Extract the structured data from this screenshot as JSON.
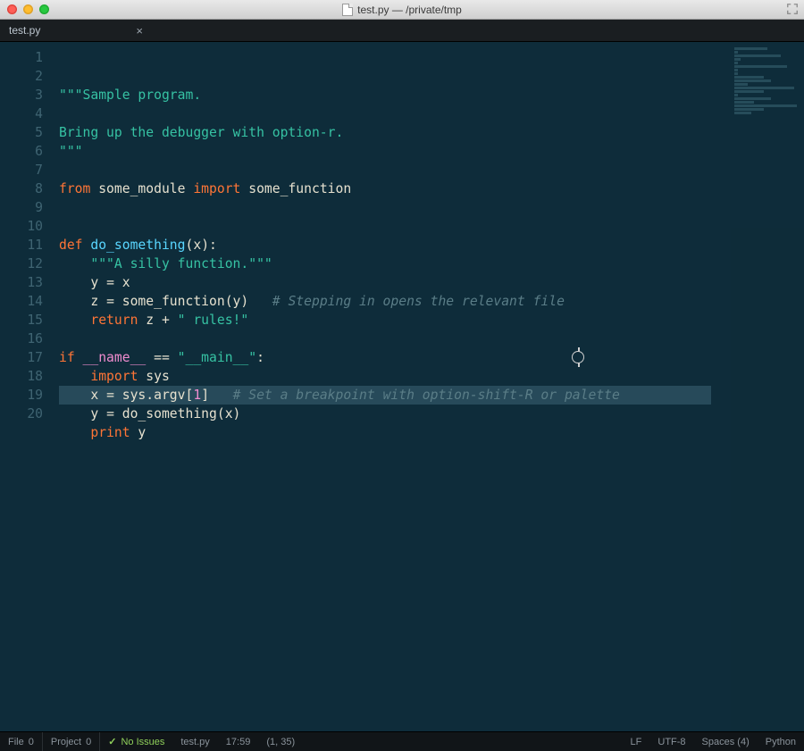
{
  "window": {
    "title": "test.py — /private/tmp"
  },
  "tabs": [
    {
      "label": "test.py",
      "active": true
    }
  ],
  "gutter": {
    "from": 1,
    "to": 20
  },
  "code": {
    "lines": [
      {
        "n": 1,
        "tokens": [
          [
            "str",
            "\"\"\"Sample program."
          ]
        ]
      },
      {
        "n": 2,
        "tokens": []
      },
      {
        "n": 3,
        "tokens": [
          [
            "str",
            "Bring up the debugger with option-r."
          ]
        ]
      },
      {
        "n": 4,
        "tokens": [
          [
            "str",
            "\"\"\""
          ]
        ]
      },
      {
        "n": 5,
        "tokens": []
      },
      {
        "n": 6,
        "tokens": [
          [
            "kw",
            "from"
          ],
          [
            "pln",
            " some_module "
          ],
          [
            "kw",
            "import"
          ],
          [
            "pln",
            " some_function"
          ]
        ]
      },
      {
        "n": 7,
        "tokens": []
      },
      {
        "n": 8,
        "tokens": []
      },
      {
        "n": 9,
        "tokens": [
          [
            "kw",
            "def "
          ],
          [
            "fn",
            "do_something"
          ],
          [
            "pln",
            "("
          ],
          [
            "pln",
            "x"
          ],
          [
            "pln",
            "):"
          ]
        ]
      },
      {
        "n": 10,
        "tokens": [
          [
            "pln",
            "    "
          ],
          [
            "str",
            "\"\"\"A silly function.\"\"\""
          ]
        ]
      },
      {
        "n": 11,
        "tokens": [
          [
            "pln",
            "    y "
          ],
          [
            "op",
            "="
          ],
          [
            "pln",
            " x"
          ]
        ]
      },
      {
        "n": 12,
        "tokens": [
          [
            "pln",
            "    z "
          ],
          [
            "op",
            "="
          ],
          [
            "pln",
            " some_function(y)   "
          ],
          [
            "cmt",
            "# Stepping in opens the relevant file"
          ]
        ]
      },
      {
        "n": 13,
        "tokens": [
          [
            "pln",
            "    "
          ],
          [
            "kw",
            "return"
          ],
          [
            "pln",
            " z "
          ],
          [
            "op",
            "+"
          ],
          [
            "pln",
            " "
          ],
          [
            "str",
            "\" rules!\""
          ]
        ]
      },
      {
        "n": 14,
        "tokens": []
      },
      {
        "n": 15,
        "tokens": [
          [
            "kw",
            "if"
          ],
          [
            "pln",
            " "
          ],
          [
            "dunder",
            "__name__"
          ],
          [
            "pln",
            " "
          ],
          [
            "op",
            "=="
          ],
          [
            "pln",
            " "
          ],
          [
            "str",
            "\"__main__\""
          ],
          [
            "pln",
            ":"
          ]
        ]
      },
      {
        "n": 16,
        "tokens": [
          [
            "pln",
            "    "
          ],
          [
            "kw",
            "import"
          ],
          [
            "pln",
            " sys"
          ]
        ]
      },
      {
        "n": 17,
        "tokens": [
          [
            "pln",
            "    x "
          ],
          [
            "op",
            "="
          ],
          [
            "pln",
            " sys.argv["
          ],
          [
            "num",
            "1"
          ],
          [
            "pln",
            "]   "
          ],
          [
            "cmt",
            "# Set a breakpoint with option-shift-R or palette"
          ]
        ],
        "selected": true
      },
      {
        "n": 18,
        "tokens": [
          [
            "pln",
            "    y "
          ],
          [
            "op",
            "="
          ],
          [
            "pln",
            " do_something(x)"
          ]
        ]
      },
      {
        "n": 19,
        "tokens": [
          [
            "pln",
            "    "
          ],
          [
            "kw",
            "print"
          ],
          [
            "pln",
            " y"
          ]
        ]
      },
      {
        "n": 20,
        "tokens": []
      }
    ]
  },
  "status": {
    "file": {
      "label": "File",
      "count": "0"
    },
    "project": {
      "label": "Project",
      "count": "0"
    },
    "issues": {
      "label": "No Issues"
    },
    "filename": "test.py",
    "time": "17:59",
    "cursor": "(1, 35)",
    "eol": "LF",
    "encoding": "UTF-8",
    "indent": "Spaces (4)",
    "lang": "Python"
  }
}
